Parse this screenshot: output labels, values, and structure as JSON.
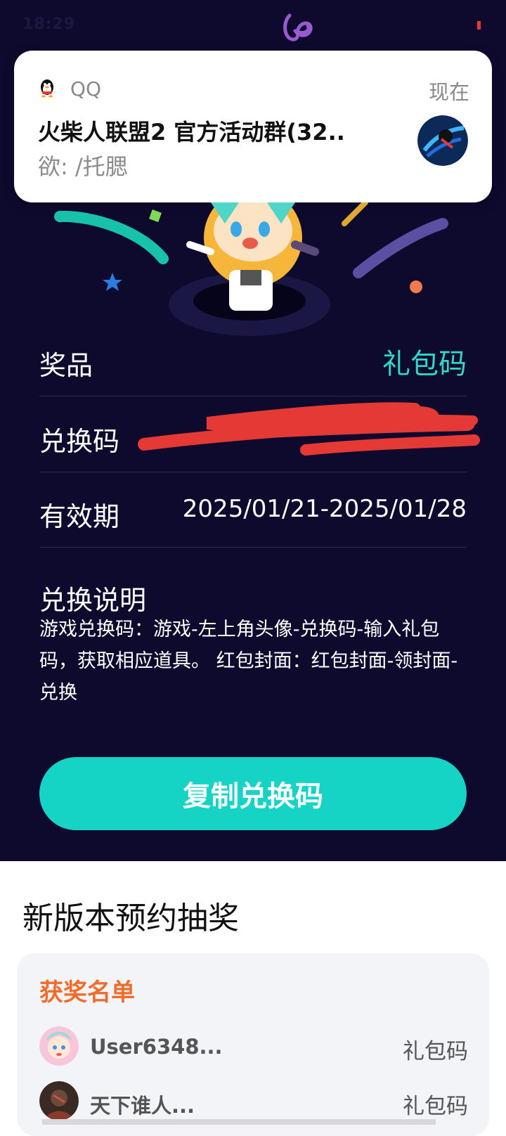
{
  "status_bar": {
    "time_text": "18:29",
    "accent_color": "#9b59d0"
  },
  "notification": {
    "app_name": "QQ",
    "time": "现在",
    "title": "火柴人联盟2 官方活动群(32..",
    "message": "欲: /托腮",
    "app_icon": "qq-penguin-icon"
  },
  "details": {
    "prize_label": "奖品",
    "prize_value": "礼包码",
    "code_label": "兑换码",
    "validity_label": "有效期",
    "validity_value": "2025/01/21-2025/01/28",
    "instructions_title": "兑换说明",
    "instructions_text": "游戏兑换码：游戏-左上角头像-兑换码-输入礼包码，获取相应道具。 红包封面：红包封面-领封面-兑换"
  },
  "copy_button": {
    "label": "复制兑换码",
    "color": "#15d4c6"
  },
  "lottery": {
    "section_title": "新版本预约抽奖",
    "winners_title": "获奖名单",
    "winners": [
      {
        "name": "User6348...",
        "prize": "礼包码"
      },
      {
        "name": "天下谁人...",
        "prize": "礼包码"
      }
    ]
  },
  "colors": {
    "background_dark": "#0d0a2e",
    "accent_teal": "#2fd8c8",
    "winners_title": "#f06c2c"
  }
}
